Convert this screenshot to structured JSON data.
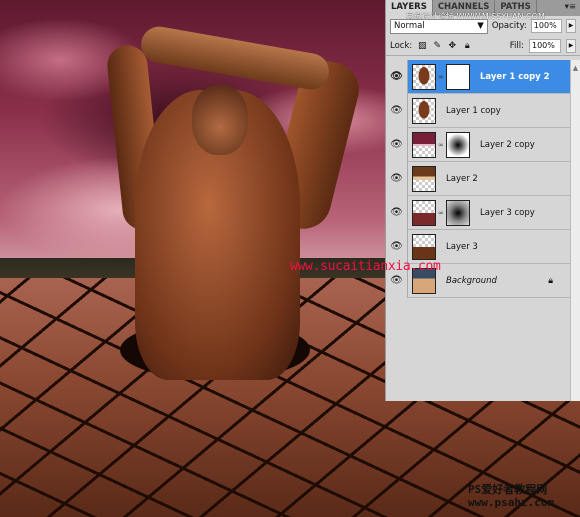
{
  "panel": {
    "tabs": [
      "LAYERS",
      "CHANNELS",
      "PATHS"
    ],
    "site_watermark": "思缘设计论坛 WWW.MISSYUAN.COM",
    "blend_mode": "Normal",
    "opacity_label": "Opacity:",
    "opacity": "100%",
    "lock_label": "Lock:",
    "fill_label": "Fill:",
    "fill": "100%",
    "layers": [
      {
        "name": "Layer 1 copy 2",
        "selected": true,
        "mask": "white",
        "thumb": "man"
      },
      {
        "name": "Layer 1 copy",
        "thumb": "man"
      },
      {
        "name": "Layer 2 copy",
        "mask": "radial",
        "thumb": "sky"
      },
      {
        "name": "Layer 2",
        "thumb": "sky-warm"
      },
      {
        "name": "Layer 3 copy",
        "mask": "radial",
        "thumb": "ground"
      },
      {
        "name": "Layer 3",
        "thumb": "ground"
      },
      {
        "name": "Background",
        "locked": true,
        "thumb": "background"
      }
    ]
  },
  "image_watermark": "www.sucaitianxia.com",
  "credit": {
    "line1": "PS爱好者教程网",
    "line2": "www.psahz.com"
  },
  "colors": {
    "selection": "#3c8ce6",
    "watermark": "#ee1146"
  }
}
